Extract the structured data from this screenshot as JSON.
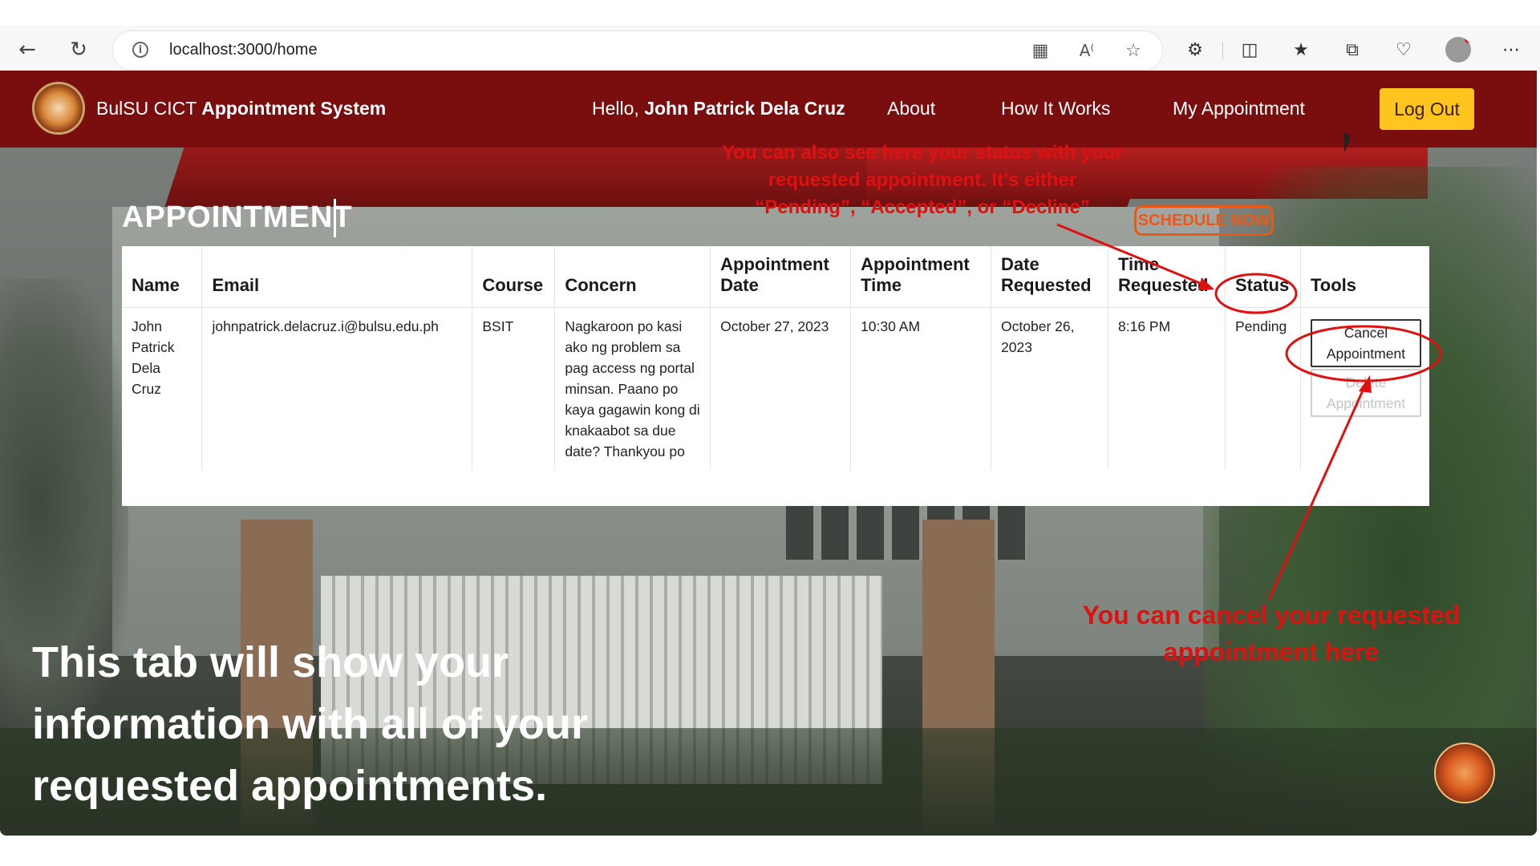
{
  "browser": {
    "url": "localhost:3000/home",
    "icons": {
      "back": "back-arrow-icon",
      "reload": "reload-icon",
      "info": "info-icon",
      "apps": "apps-icon",
      "read_aloud": "read-aloud-icon",
      "favorite": "star-icon",
      "extensions": "puzzle-icon",
      "split": "split-screen-icon",
      "favorites": "favorites-icon",
      "collections": "collections-icon",
      "health": "heart-icon",
      "more": "more-icon"
    }
  },
  "header": {
    "brand_prefix": "BulSU CICT ",
    "brand_bold": "Appointment System",
    "greeting_prefix": "Hello, ",
    "greeting_name": "John Patrick Dela Cruz",
    "nav": [
      "About",
      "How It Works",
      "My Appointment"
    ],
    "logout": "Log Out"
  },
  "page": {
    "title": "APPOINTMENT",
    "schedule_button": "SCHEDULE NOW"
  },
  "table": {
    "headers": [
      "Name",
      "Email",
      "Course",
      "Concern",
      "Appointment Date",
      "Appointment Time",
      "Date Requested",
      "Time Requested",
      "Status",
      "Tools"
    ],
    "row": {
      "name": "John Patrick Dela Cruz",
      "email": "johnpatrick.delacruz.i@bulsu.edu.ph",
      "course": "BSIT",
      "concern": "Nagkaroon po kasi ako ng problem sa pag access ng portal minsan. Paano po kaya gagawin kong di knakaabot sa due date? Thankyou po",
      "appointment_date": "October 27, 2023",
      "appointment_time": "10:30 AM",
      "date_requested": "October 26, 2023",
      "time_requested": "8:16 PM",
      "status": "Pending",
      "cancel_button": "Cancel Appointment",
      "delete_button": "Delete Appointment"
    }
  },
  "annotations": {
    "status_note": "You can also see here your status with your requested appointment. It’s either “Pending”, “Accepted”, or “Decline”",
    "cancel_note": "You can cancel your requested appointment here",
    "caption": "This tab will show your information with all of your requested appointments."
  },
  "colors": {
    "header_bg": "#7a0d0d",
    "logout_bg": "#ffc51e",
    "annotation_red": "#e01010",
    "schedule_orange": "#e65a16"
  }
}
